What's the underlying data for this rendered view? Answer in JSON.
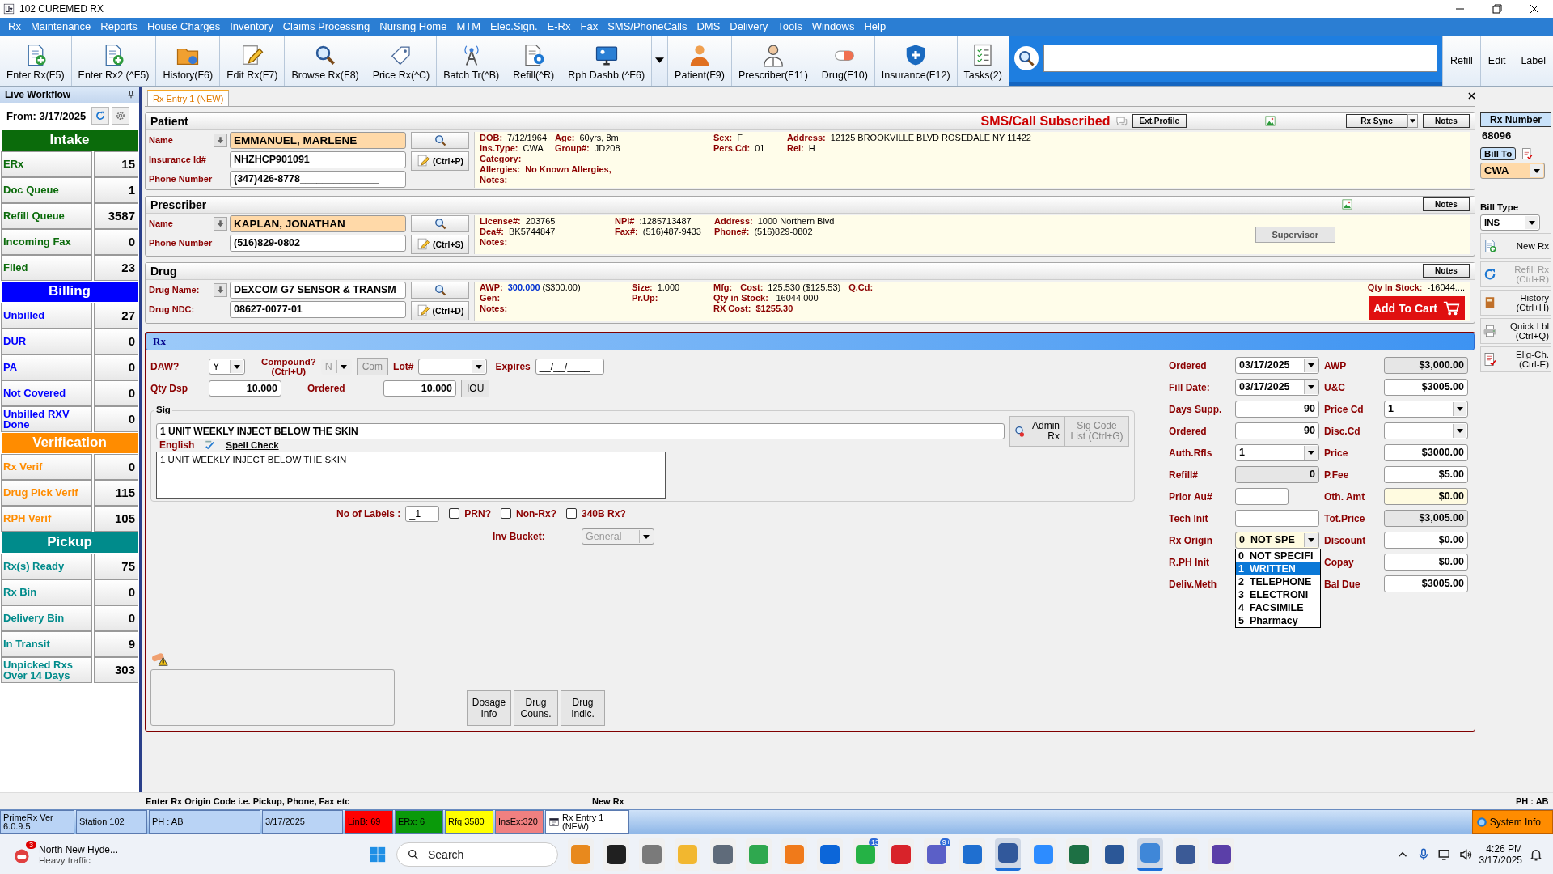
{
  "window": {
    "title": "102 CUREMED RX"
  },
  "menu": [
    "Rx",
    "Maintenance",
    "Reports",
    "House Charges",
    "Inventory",
    "Claims Processing",
    "Nursing Home",
    "MTM",
    "Elec.Sign.",
    "E-Rx",
    "Fax",
    "SMS/PhoneCalls",
    "DMS",
    "Delivery",
    "Tools",
    "Windows",
    "Help"
  ],
  "toolbar": {
    "buttons": [
      {
        "label": "Enter Rx(F5)",
        "dropdown": false
      },
      {
        "label": "Enter Rx2 (^F5)",
        "dropdown": false
      },
      {
        "label": "History(F6)",
        "dropdown": false
      },
      {
        "label": "Edit Rx(F7)",
        "dropdown": false
      },
      {
        "label": "Browse Rx(F8)",
        "dropdown": false
      },
      {
        "label": "Price Rx(^C)",
        "dropdown": false
      },
      {
        "label": "Batch Tr(^B)",
        "dropdown": false
      },
      {
        "label": "Refill(^R)",
        "dropdown": false
      },
      {
        "label": "Rph Dashb.(^F6)",
        "dropdown": true
      },
      {
        "label": "Patient(F9)",
        "dropdown": false
      },
      {
        "label": "Prescriber(F11)",
        "dropdown": false
      },
      {
        "label": "Drug(F10)",
        "dropdown": false
      },
      {
        "label": "Insurance(F12)",
        "dropdown": false
      },
      {
        "label": "Tasks(2)",
        "dropdown": false
      }
    ],
    "actions": [
      "Refill",
      "Edit",
      "Label"
    ]
  },
  "sidebar": {
    "title": "Live Workflow",
    "from": "From: 3/17/2025",
    "groups": [
      {
        "name": "Intake",
        "color": "#0b6b0b",
        "items": [
          {
            "label": "ERx",
            "count": "15"
          },
          {
            "label": "Doc Queue",
            "count": "1"
          },
          {
            "label": "Refill Queue",
            "count": "3587"
          },
          {
            "label": "Incoming Fax",
            "count": "0"
          },
          {
            "label": "Filed",
            "count": "23"
          }
        ]
      },
      {
        "name": "Billing",
        "color": "#0000ff",
        "items": [
          {
            "label": "Unbilled",
            "count": "27"
          },
          {
            "label": "DUR",
            "count": "0"
          },
          {
            "label": "PA",
            "count": "0"
          },
          {
            "label": "Not Covered",
            "count": "0"
          },
          {
            "label": "Unbilled RXV Done",
            "count": "0"
          }
        ]
      },
      {
        "name": "Verification",
        "color": "#ff8c00",
        "items": [
          {
            "label": "Rx Verif",
            "count": "0"
          },
          {
            "label": "Drug Pick Verif",
            "count": "115"
          },
          {
            "label": "RPH Verif",
            "count": "105"
          }
        ]
      },
      {
        "name": "Pickup",
        "color": "#008b8b",
        "items": [
          {
            "label": "Rx(s) Ready",
            "count": "75"
          },
          {
            "label": "Rx Bin",
            "count": "0"
          },
          {
            "label": "Delivery Bin",
            "count": "0"
          },
          {
            "label": "In Transit",
            "count": "9"
          },
          {
            "label": "Unpicked Rxs Over 14 Days",
            "count": "303"
          }
        ]
      }
    ]
  },
  "tabs": [
    {
      "label": "Rx Entry 1 (NEW)",
      "selected": true
    }
  ],
  "patient": {
    "title": "Patient",
    "subscription": "SMS/Call Subscribed",
    "profile_button": "Ext.Profile",
    "sync_button": "Rx Sync",
    "notes_button": "Notes",
    "hotkey": "(Ctrl+P)",
    "fields": [
      {
        "label": "Name",
        "value": "EMMANUEL, MARLENE",
        "kind": "name",
        "lookup": true
      },
      {
        "label": "Insurance Id#",
        "value": "NHZHCP901091",
        "kind": "text",
        "lookup": false
      },
      {
        "label": "Phone Number",
        "value": "(347)426-8778______________",
        "kind": "text",
        "lookup": false
      }
    ],
    "info": [
      [
        [
          {
            "label": "DOB:",
            "value": "7/12/1964"
          }
        ],
        [
          {
            "label": "Ins.Type:",
            "value": "CWA"
          }
        ],
        [
          {
            "label": "Category:"
          }
        ],
        [
          {
            "label": "Allergies:",
            "value": "No Known Allergies,",
            "kind": "alert"
          }
        ],
        [
          {
            "label": "Notes:"
          }
        ]
      ],
      [
        [
          {
            "label": "Age:",
            "value": "60yrs, 8m"
          }
        ],
        [
          {
            "label": "Group#:",
            "value": "JD208"
          }
        ]
      ],
      [
        [
          {
            "label": "Sex:",
            "value": "F"
          }
        ],
        [
          {
            "label": "Pers.Cd:",
            "value": "01"
          }
        ]
      ],
      [
        [
          {
            "label": "Address:",
            "value": "12125 BROOKVILLE BLVD  ROSEDALE NY 11422"
          }
        ],
        [
          {
            "label": "Rel:",
            "value": "H"
          }
        ]
      ]
    ]
  },
  "prescriber": {
    "title": "Prescriber",
    "notes_button": "Notes",
    "hotkey": "(Ctrl+S)",
    "supervisor_button": "Supervisor",
    "fields": [
      {
        "label": "Name",
        "value": "KAPLAN, JONATHAN",
        "kind": "name",
        "lookup": true
      },
      {
        "label": "Phone Number",
        "value": "(516)829-0802",
        "kind": "text",
        "lookup": false
      }
    ],
    "info": [
      [
        [
          {
            "label": "License#:",
            "value": "203765"
          }
        ],
        [
          {
            "label": "Dea#:",
            "value": "BK5744847"
          }
        ],
        [
          {
            "label": "Notes:"
          }
        ]
      ],
      [
        [
          {
            "label": "NPI#",
            "value": ":1285713487"
          }
        ],
        [
          {
            "label": "Fax#:",
            "value": "(516)487-9433"
          }
        ]
      ],
      [
        [
          {
            "label": "Address:",
            "value": "1000 Northern Blvd"
          }
        ],
        [
          {
            "label": "Phone#:",
            "value": "(516)829-0802"
          }
        ]
      ]
    ]
  },
  "drug": {
    "title": "Drug",
    "notes_button": "Notes",
    "hotkey": "(Ctrl+D)",
    "stock_label": "Qty In Stock:",
    "stock_value": "-16044....",
    "cart_button": "Add To Cart",
    "fields": [
      {
        "label": "Drug Name:",
        "value": "DEXCOM G7 SENSOR & TRANSM",
        "kind": "text",
        "lookup": true
      },
      {
        "label": "Drug NDC:",
        "value": "08627-0077-01",
        "kind": "text",
        "lookup": false
      }
    ],
    "info": [
      [
        [
          {
            "label": "AWP:",
            "value": "**300.000** ($300.00)"
          }
        ],
        [
          {
            "label": "Gen:"
          }
        ],
        [
          {
            "label": "Notes:"
          }
        ]
      ],
      [
        [
          {
            "label": "Size:",
            "value": "1.000"
          }
        ],
        [
          {
            "label": "Pr.Up:"
          }
        ]
      ],
      [
        [
          {
            "label": "Mfg:"
          },
          {
            "label": "Cost:",
            "value": "125.530 ($125.53)"
          },
          {
            "label": "Q.Cd:"
          }
        ],
        [
          {
            "label": "Qty in Stock:",
            "value": "-16044.000"
          }
        ],
        [
          {
            "label": "RX Cost:",
            "value": "$1255.30",
            "kind": "alert"
          }
        ]
      ]
    ]
  },
  "rx": {
    "title": "Rx",
    "daw": {
      "label": "DAW?",
      "value": "Y"
    },
    "compound": {
      "label": "Compound?",
      "hotkey": "(Ctrl+U)",
      "value": "N",
      "button": "Com",
      "disabled": true
    },
    "lot": {
      "label": "Lot#"
    },
    "expires": {
      "label": "Expires",
      "value": "__/__/____"
    },
    "qty": {
      "label": "Qty Dsp",
      "value": "10.000"
    },
    "ordered": {
      "label": "Ordered",
      "value": "10.000",
      "button": "IOU"
    },
    "sig": {
      "title": "Sig",
      "code": "1 UNIT WEEKLY INJECT BELOW THE SKIN",
      "admin_button": "Admin Rx",
      "code_list_button": "Sig Code List (Ctrl+G)",
      "code_list_disabled": true,
      "language": "English",
      "spell_check": "Spell Check",
      "text": "1 UNIT WEEKLY INJECT BELOW THE SKIN"
    },
    "labels": {
      "label": "No of Labels :",
      "value": "_1"
    },
    "options": [
      {
        "label": "PRN?",
        "checked": false
      },
      {
        "label": "Non-Rx?",
        "checked": false
      },
      {
        "label": "340B Rx?",
        "checked": false
      }
    ],
    "bucket": {
      "label": "Inv Bucket:",
      "value": "General",
      "disabled": true
    },
    "info_buttons": [
      "Dosage Info",
      "Drug Couns.",
      "Drug Indic."
    ],
    "fill_fields": [
      {
        "label": "Ordered",
        "value": "03/17/2025",
        "kind": "combo"
      },
      {
        "label": "Fill Date:",
        "value": "03/17/2025",
        "kind": "combo"
      },
      {
        "label": "Days Supp.",
        "value": "90",
        "kind": "text"
      },
      {
        "label": "Ordered",
        "value": "90",
        "kind": "text"
      },
      {
        "label": "Auth.Rfls",
        "value": "1",
        "kind": "combo"
      },
      {
        "label": "Refill#",
        "value": "0",
        "kind": "readonly"
      },
      {
        "label": "Prior Au#",
        "kind": "short"
      },
      {
        "label": "Tech Init",
        "kind": "text"
      },
      {
        "label": "Rx Origin",
        "value": "0  NOT SPE",
        "kind": "note-combo",
        "options": [
          {
            "label": "0  NOT SPECIFI",
            "selected": false
          },
          {
            "label": "1  WRITTEN",
            "selected": true
          },
          {
            "label": "2  TELEPHONE",
            "selected": false
          },
          {
            "label": "3  ELECTRONI",
            "selected": false
          },
          {
            "label": "4  FACSIMILE",
            "selected": false
          },
          {
            "label": "5  Pharmacy",
            "selected": false
          }
        ]
      },
      {
        "label": "R.PH Init"
      },
      {
        "label": "Deliv.Meth"
      }
    ],
    "price_fields": [
      {
        "label": "AWP",
        "value": "$3,000.00",
        "kind": "readonly"
      },
      {
        "label": "U&C",
        "value": "$3005.00",
        "kind": "text"
      },
      {
        "label": "Price Cd",
        "value": "1",
        "kind": "combo"
      },
      {
        "label": "Disc.Cd",
        "kind": "combo"
      },
      {
        "label": "Price",
        "value": "$3000.00",
        "kind": "text"
      },
      {
        "label": "P.Fee",
        "value": "$5.00",
        "kind": "text"
      },
      {
        "label": "Oth. Amt",
        "value": "$0.00",
        "kind": "note"
      },
      {
        "label": "Tot.Price",
        "value": "$3,005.00",
        "kind": "readonly"
      },
      {
        "label": "Discount",
        "value": "$0.00",
        "kind": "text"
      },
      {
        "label": "Copay",
        "value": "$0.00",
        "kind": "text"
      },
      {
        "label": "Bal Due",
        "value": "$3005.00",
        "kind": "text"
      }
    ]
  },
  "side": {
    "rx_number": {
      "label": "Rx Number",
      "value": "68096"
    },
    "bill_to": {
      "label": "Bill To",
      "value": "CWA"
    },
    "bill_type": {
      "label": "Bill Type",
      "value": "INS"
    },
    "buttons": [
      {
        "label": "New Rx",
        "disabled": false
      },
      {
        "label": "Refill Rx (Ctrl+R)",
        "disabled": true
      },
      {
        "label": "History (Ctrl+H)",
        "disabled": false
      },
      {
        "label": "Quick Lbl (Ctrl+Q)",
        "disabled": false
      },
      {
        "label": "Elig-Ch. (Ctrl-E)",
        "disabled": false
      }
    ]
  },
  "hint_bar": [
    "Enter Rx Origin Code i.e. Pickup, Phone, Fax etc",
    "New Rx",
    "PH : AB"
  ],
  "status_bar": [
    {
      "text": "PrimeRx Ver 6.0.9.5",
      "color": "#b9d3f5",
      "kind": "text"
    },
    {
      "text": "Station 102",
      "color": "#b9d3f5",
      "kind": "text"
    },
    {
      "text": "PH : AB",
      "color": "#b9d3f5",
      "kind": "text"
    },
    {
      "text": "3/17/2025",
      "color": "#b9d3f5",
      "kind": "text"
    },
    {
      "text": "LinB: 69",
      "color": "#ff0000",
      "kind": "text"
    },
    {
      "text": "ERx: 6",
      "color": "#0a9a0a",
      "kind": "text"
    },
    {
      "text": "Rfq:3580",
      "color": "#ffff00",
      "kind": "text"
    },
    {
      "text": "InsEx:320",
      "color": "#f08080",
      "kind": "text"
    },
    {
      "text": "Rx Entry 1 (NEW)",
      "color": "#ffffff",
      "kind": "window"
    }
  ],
  "system_info": "System Info",
  "taskbar": {
    "weather": {
      "badge": "3",
      "title": "North New Hyde...",
      "subtitle": "Heavy traffic"
    },
    "search": {
      "placeholder": "Search"
    },
    "apps": [
      {
        "color": "#e8891d",
        "selected": false
      },
      {
        "color": "#202020",
        "selected": false
      },
      {
        "color": "#7a7a7a",
        "selected": false
      },
      {
        "color": "#f2b72f",
        "selected": false
      },
      {
        "color": "#5f6b7a",
        "selected": false
      },
      {
        "color": "#2fa84f",
        "selected": false
      },
      {
        "color": "#f07a1a",
        "selected": false
      },
      {
        "color": "#0c66d9",
        "selected": false
      },
      {
        "color": "#25b245",
        "selected": false,
        "badge": "13"
      },
      {
        "color": "#d8232a",
        "selected": false
      },
      {
        "color": "#5b5fc7",
        "selected": false,
        "badge": "9+"
      },
      {
        "color": "#1f6fd0",
        "selected": false
      },
      {
        "color": "#31589b",
        "selected": true
      },
      {
        "color": "#2d8cff",
        "selected": false
      },
      {
        "color": "#1d7044",
        "selected": false
      },
      {
        "color": "#2b5797",
        "selected": false
      },
      {
        "color": "#3f87d8",
        "selected": true
      },
      {
        "color": "#3b5a96",
        "selected": false
      },
      {
        "color": "#5b3fa8",
        "selected": false
      }
    ],
    "time": "4:26 PM",
    "date": "3/17/2025"
  }
}
